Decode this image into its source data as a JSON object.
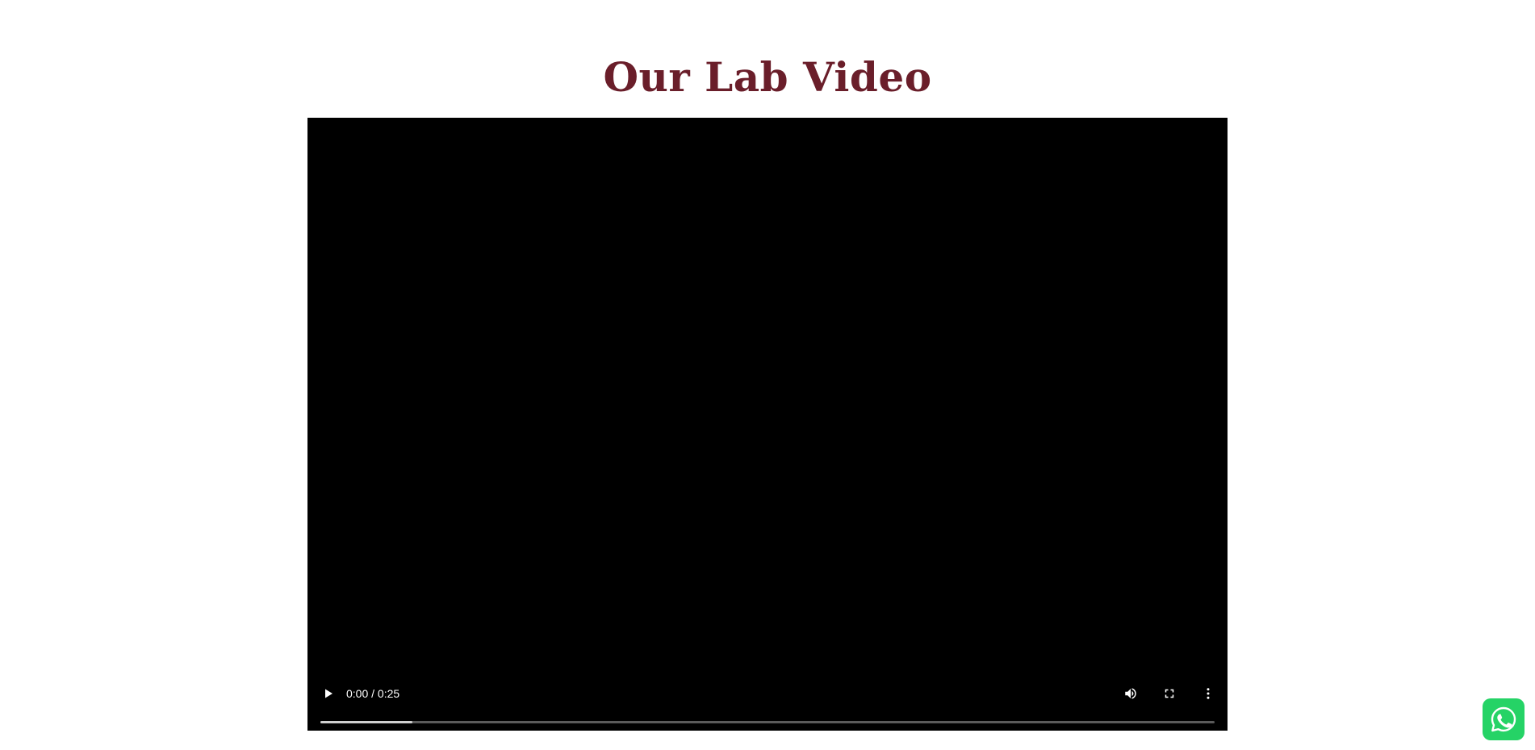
{
  "section": {
    "title": "Our Lab Video"
  },
  "video_player": {
    "time_display": "0:00 / 0:25",
    "buffered_fraction": 0.103
  },
  "icons": {
    "play": "play-icon",
    "volume": "volume-icon",
    "fullscreen": "fullscreen-icon",
    "menu": "more-vertical-icon",
    "whatsapp": "whatsapp-icon"
  },
  "colors": {
    "title": "#6a1e2a",
    "video_background": "#000000",
    "whatsapp": "#25d366"
  }
}
